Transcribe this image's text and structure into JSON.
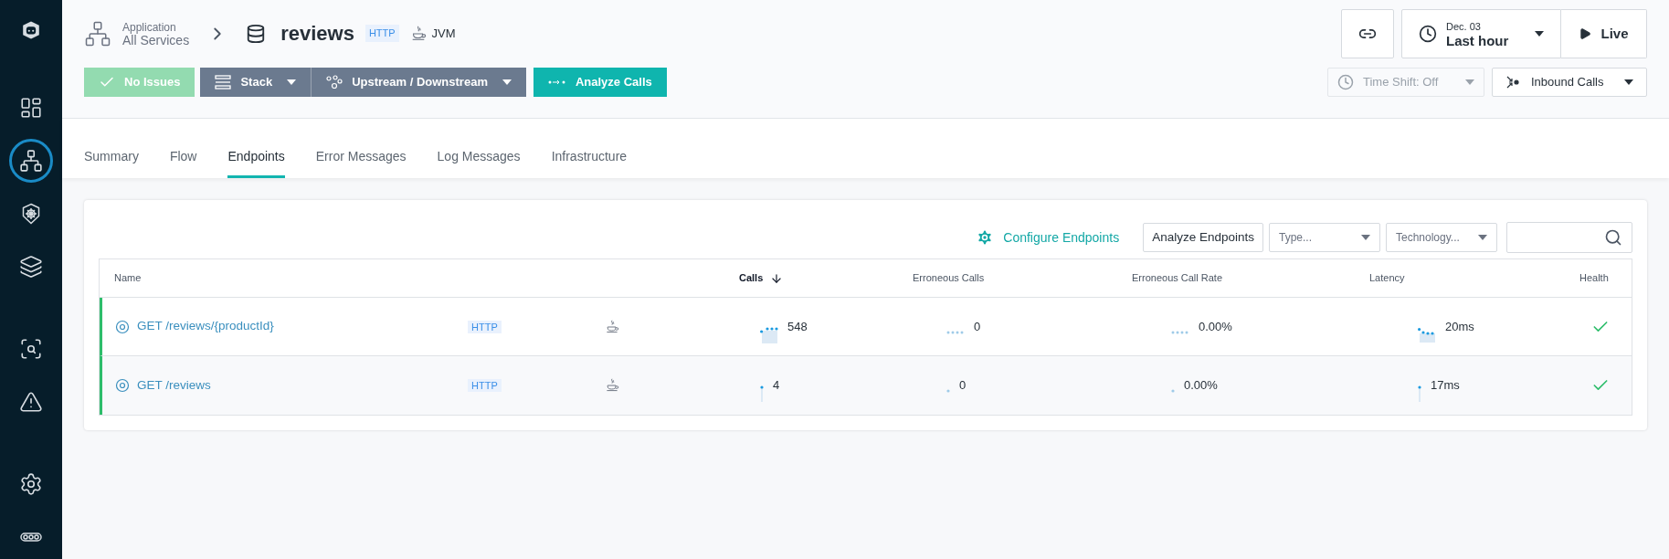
{
  "sidebar": {
    "items": [
      {
        "kind": "dashboard",
        "selected": false
      },
      {
        "kind": "applications",
        "selected": true
      },
      {
        "kind": "kubernetes",
        "selected": false
      },
      {
        "kind": "stack",
        "selected": false
      },
      {
        "kind": "analyze",
        "selected": false
      },
      {
        "kind": "events",
        "selected": false
      },
      {
        "kind": "settings",
        "selected": false
      },
      {
        "kind": "more",
        "selected": false
      }
    ]
  },
  "breadcrumb": {
    "label": "Application",
    "value": "All Services"
  },
  "service": {
    "name": "reviews",
    "badge": "HTTP",
    "technology": "JVM"
  },
  "actions": [
    {
      "label": "No Issues",
      "kind": "status",
      "disabled": true
    },
    {
      "label": "Stack",
      "kind": "dropdown",
      "disabled": false
    },
    {
      "label": "Upstream / Downstream",
      "kind": "dropdown",
      "disabled": false
    },
    {
      "label": "Analyze Calls",
      "kind": "primary",
      "disabled": false
    }
  ],
  "time": {
    "date": "Dec. 03",
    "range": "Last hour",
    "live": "Live"
  },
  "time_shift": {
    "label": "Time Shift: Off",
    "disabled": true
  },
  "direction": {
    "label": "Inbound Calls"
  },
  "tabs": [
    {
      "label": "Summary",
      "selected": false
    },
    {
      "label": "Flow",
      "selected": false
    },
    {
      "label": "Endpoints",
      "selected": true
    },
    {
      "label": "Error Messages",
      "selected": false
    },
    {
      "label": "Log Messages",
      "selected": false
    },
    {
      "label": "Infrastructure",
      "selected": false
    }
  ],
  "toolbar": {
    "configure": "Configure Endpoints",
    "analyze": "Analyze Endpoints",
    "type_placeholder": "Type...",
    "technology_placeholder": "Technology..."
  },
  "table": {
    "columns": [
      {
        "label": "Name",
        "sorted": false
      },
      {
        "label": "Calls",
        "sorted": true
      },
      {
        "label": "Erroneous Calls",
        "sorted": false
      },
      {
        "label": "Erroneous Call Rate",
        "sorted": false
      },
      {
        "label": "Latency",
        "sorted": false
      },
      {
        "label": "Health",
        "sorted": false
      }
    ],
    "rows": [
      {
        "name": "GET /reviews/{productId}",
        "badge": "HTTP",
        "calls": "548",
        "errors": "0",
        "error_rate": "0.00%",
        "latency": "20ms",
        "healthy": true
      },
      {
        "name": "GET /reviews",
        "badge": "HTTP",
        "calls": "4",
        "errors": "0",
        "error_rate": "0.00%",
        "latency": "17ms",
        "healthy": true
      }
    ]
  }
}
